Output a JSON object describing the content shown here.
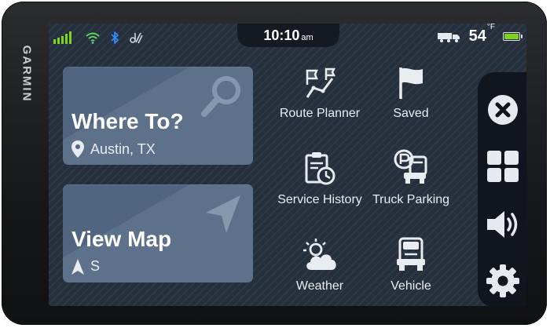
{
  "brand": "GARMIN",
  "status": {
    "time": "10:10",
    "ampm": "am",
    "temperature": "54",
    "temperature_unit": "°F",
    "battery_level": 1.0,
    "icons": [
      "signal-bars-icon",
      "wifi-icon",
      "bluetooth-icon",
      "data-link-icon",
      "truck-icon",
      "battery-icon"
    ]
  },
  "cards": {
    "where_to": {
      "title": "Where To?",
      "subtitle": "Austin, TX"
    },
    "view_map": {
      "title": "View Map",
      "subtitle": "S"
    }
  },
  "apps": [
    {
      "label": "Route Planner",
      "icon": "route-planner-icon"
    },
    {
      "label": "Saved",
      "icon": "flag-icon"
    },
    {
      "label": "Service History",
      "icon": "clipboard-clock-icon"
    },
    {
      "label": "Truck Parking",
      "icon": "truck-parking-icon"
    },
    {
      "label": "Weather",
      "icon": "weather-icon"
    },
    {
      "label": "Vehicle",
      "icon": "vehicle-icon"
    }
  ],
  "side_buttons": [
    "close-icon",
    "apps-grid-icon",
    "volume-icon",
    "gear-icon"
  ],
  "colors": {
    "screen_bg": "#26303d",
    "card": "#4f6580",
    "accent_green": "#7ed321",
    "wifi_green": "#5fd35f",
    "bluetooth_blue": "#2f8cff"
  }
}
